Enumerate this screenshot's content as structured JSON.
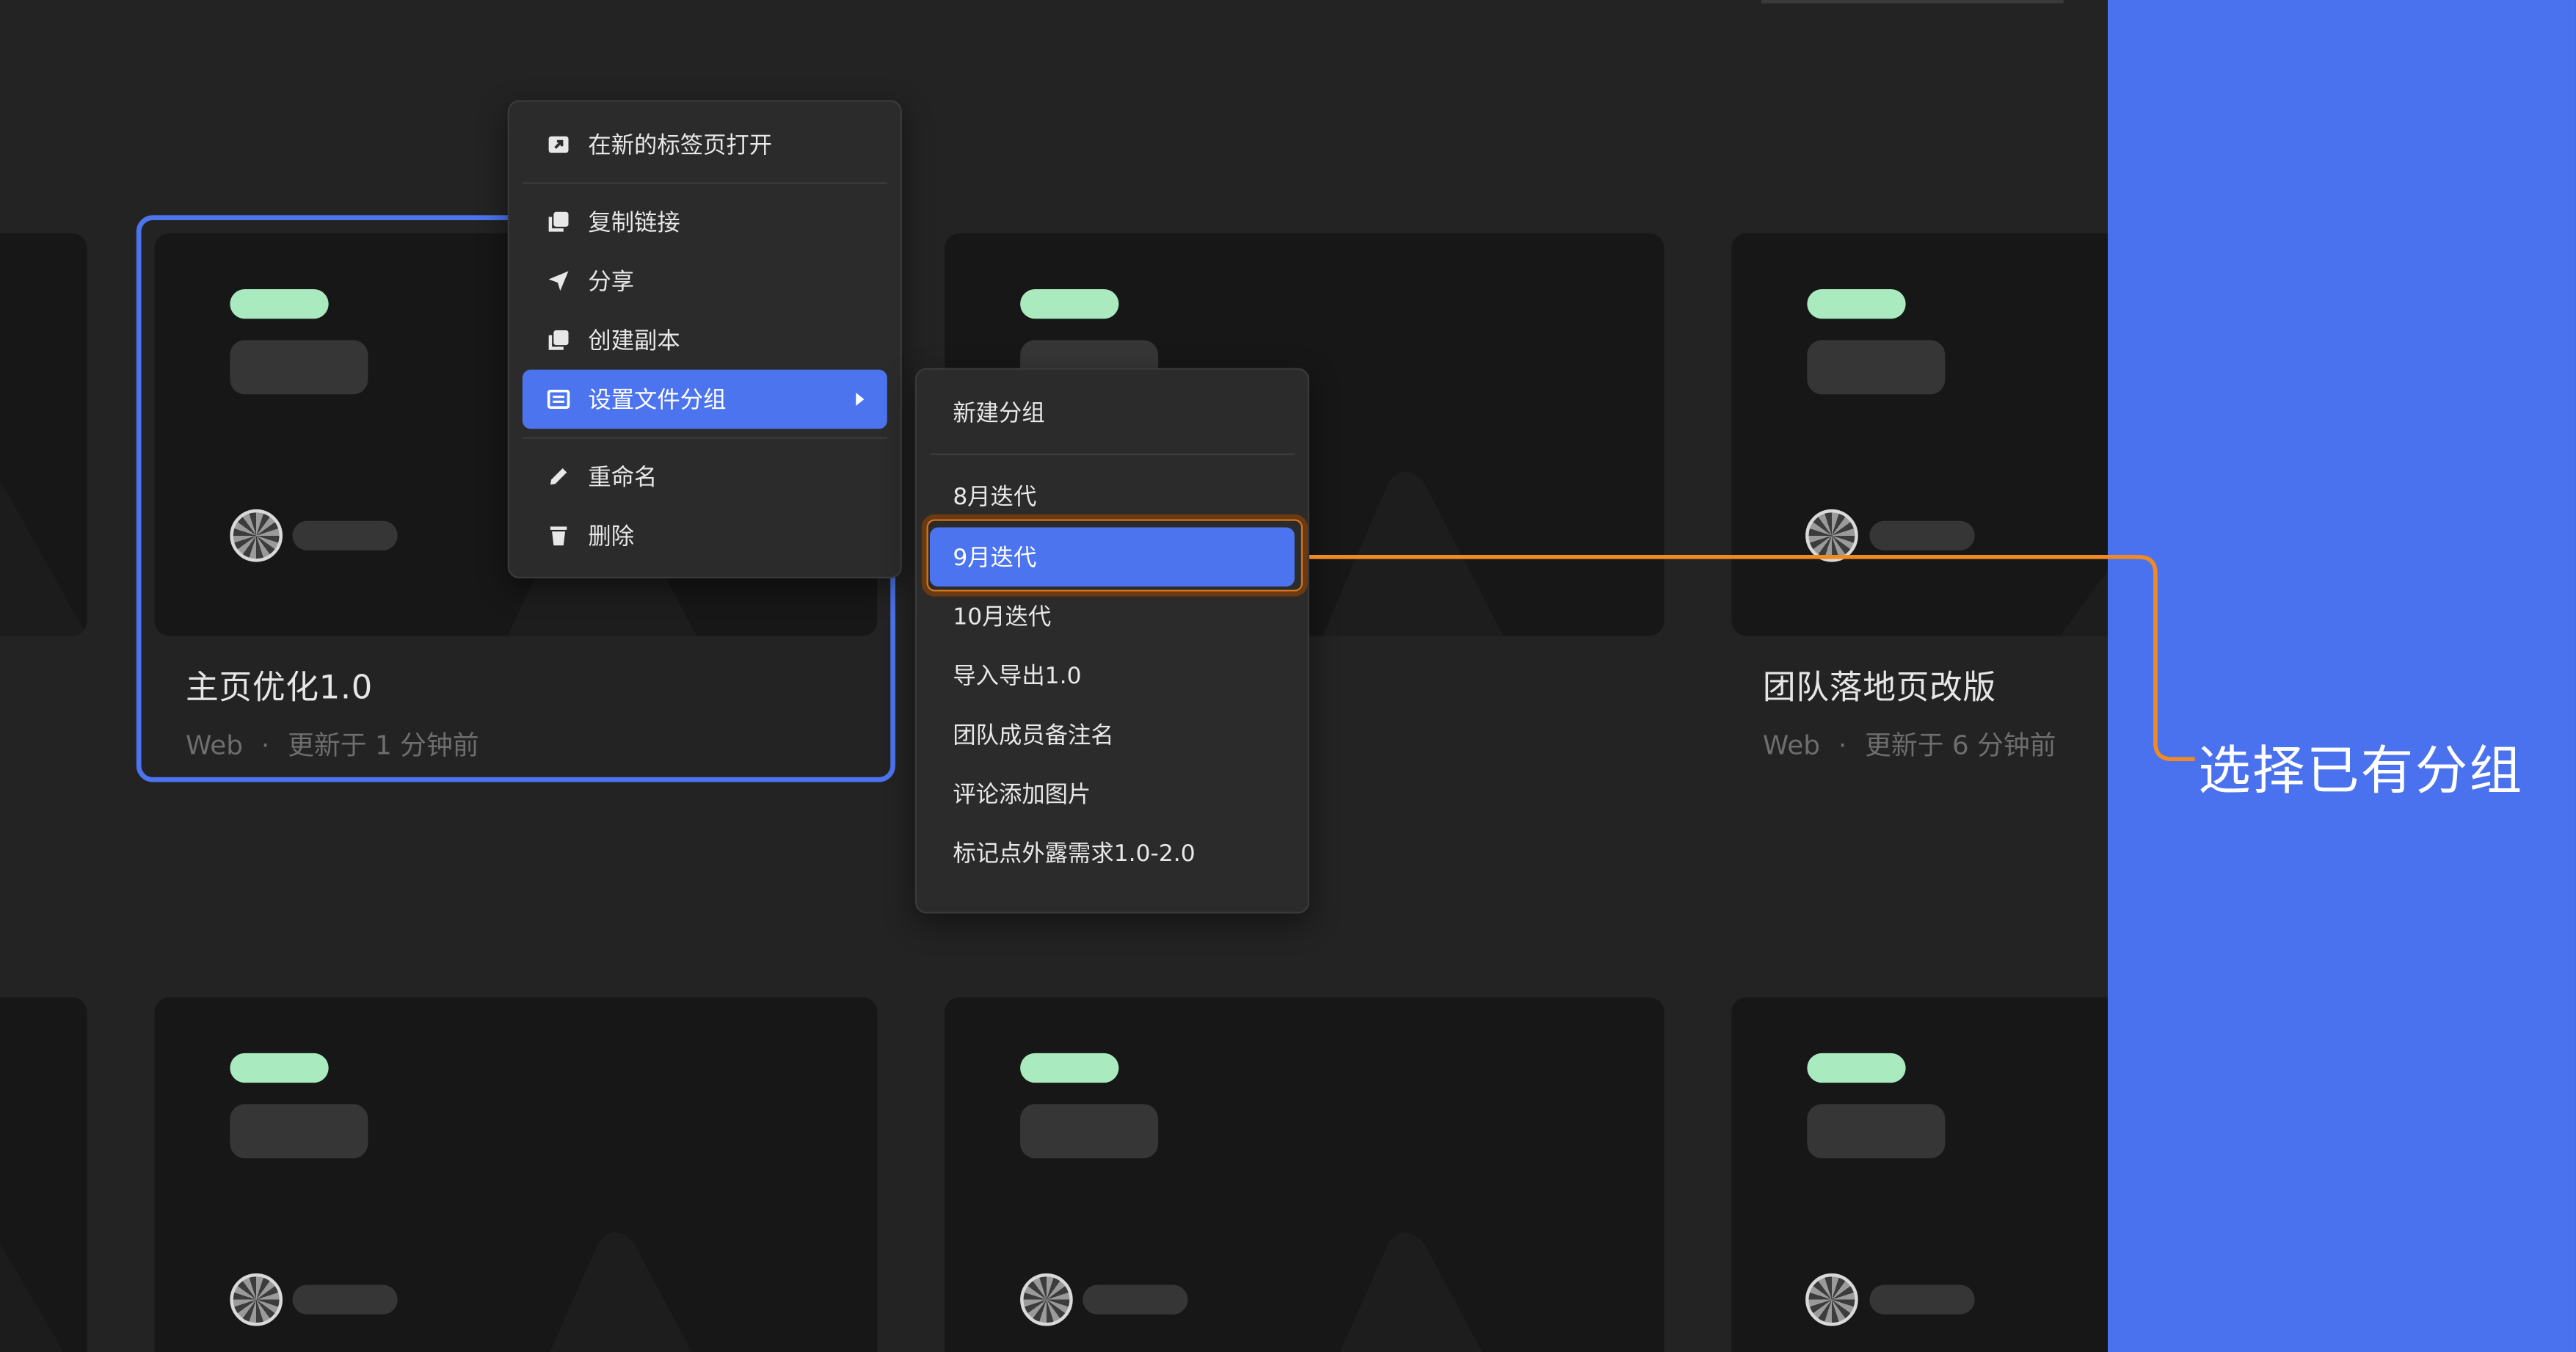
{
  "cards_row1": [
    {
      "title": "主页优化1.0",
      "platform": "Web",
      "separator": "·",
      "updated": "更新于 1 分钟前"
    },
    {
      "title": "",
      "platform": "",
      "separator": "",
      "updated": ""
    },
    {
      "title": "团队落地页改版",
      "platform": "Web",
      "separator": "·",
      "updated": "更新于 6 分钟前"
    }
  ],
  "context_menu": {
    "items": [
      {
        "label": "在新的标签页打开",
        "icon": "open-new-tab-icon"
      },
      {
        "label": "复制链接",
        "icon": "copy-link-icon"
      },
      {
        "label": "分享",
        "icon": "share-send-icon"
      },
      {
        "label": "创建副本",
        "icon": "duplicate-icon"
      },
      {
        "label": "设置文件分组",
        "icon": "group-list-icon",
        "active": true,
        "has_submenu": true
      },
      {
        "label": "重命名",
        "icon": "pencil-icon"
      },
      {
        "label": "删除",
        "icon": "trash-icon"
      }
    ]
  },
  "group_submenu": {
    "new_group": "新建分组",
    "groups": [
      "8月迭代",
      "9月迭代",
      "10月迭代",
      "导入导出1.0",
      "团队成员备注名",
      "评论添加图片",
      "标记点外露需求1.0-2.0"
    ],
    "selected_index": 1
  },
  "annotation": {
    "text": "选择已有分组",
    "line_color": "#f08a24"
  },
  "colors": {
    "accent": "#4c74ee",
    "panel": "#4b72ee",
    "tag_green": "#a9ebbf",
    "background": "#232323",
    "card": "#171717"
  }
}
